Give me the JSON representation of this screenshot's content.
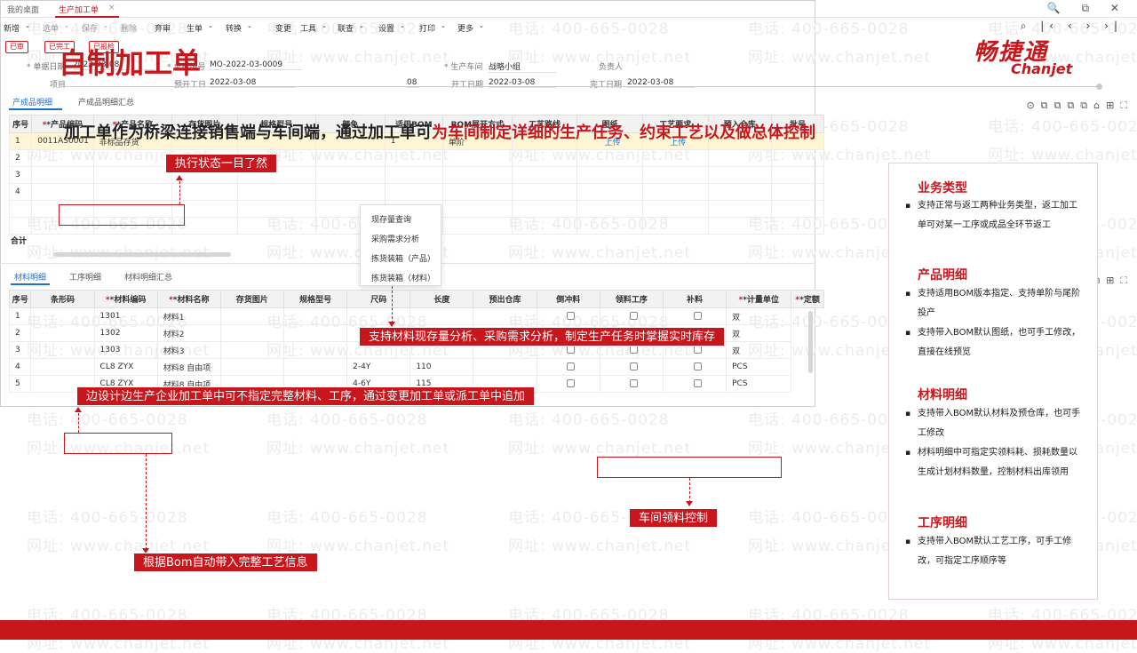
{
  "watermark": {
    "phone": "电话: 400-665-0028",
    "web": "网址: www.chanjet.net"
  },
  "slide": {
    "title": "自制加工单",
    "subtitle_plain": "加工单作为桥梁连接销售端与车间端，通过加工单可",
    "subtitle_highlight": "为车间制定详细的生产任务、约束工艺以及做总体控制",
    "logo_cn": "畅捷通",
    "logo_en": "Chanjet"
  },
  "app": {
    "tabs": [
      "我的桌面",
      "生产加工单"
    ],
    "close_icon": "×",
    "window_icons": "🔍 ⧉ ✕",
    "toolbar": [
      "新增",
      "选单",
      "保存",
      "删除",
      "弃审",
      "生单",
      "转换",
      "变更",
      "工具",
      "联查",
      "设置",
      "打印",
      "更多"
    ],
    "nav_icons": "⌕ |‹ ‹ › ›|",
    "status_buttons": [
      "已审",
      "已完工",
      "已报检"
    ],
    "fields": {
      "date_label": "* 单据日期",
      "date_value": "2022-03-08",
      "number_label": "* 单据编号",
      "number_value": "MO-2022-03-0009",
      "workshop_label": "* 生产车间",
      "workshop_value": "战略小组",
      "owner_label": "负责人",
      "project_label": "项目",
      "plan_label": "预开工日",
      "plan_value": "2022-03-08",
      "start_label": "开工日期",
      "start_value": "2022-03-08",
      "finish_label": "完工日期",
      "finish_value": "2022-03-08",
      "partial_value": "08"
    },
    "tools_dropdown": [
      "现存量查询",
      "采购需求分析",
      "拣货装箱（产品）",
      "拣货装箱（材料）"
    ],
    "product_tabs": [
      "产成品明细",
      "产成品明细汇总"
    ],
    "product_table": {
      "headers": [
        "序号",
        "*产品编码",
        "*产品名称",
        "存货图片",
        "规格型号",
        "颜色",
        "适用BOM",
        "BOM展开方式",
        "工艺路线",
        "图纸",
        "工艺要求",
        "预入仓库",
        "批号"
      ],
      "rows": [
        [
          "1",
          "0011AS0001",
          "非标品存货",
          "",
          "",
          "",
          "1",
          "单阶",
          "",
          "上传",
          "上传",
          "",
          ""
        ],
        [
          "2",
          "",
          "",
          "",
          "",
          "",
          "",
          "",
          "",
          "",
          "",
          "",
          ""
        ],
        [
          "3",
          "",
          "",
          "",
          "",
          "",
          "",
          "",
          "",
          "",
          "",
          "",
          ""
        ],
        [
          "4",
          "",
          "",
          "",
          "",
          "",
          "",
          "",
          "",
          "",
          "",
          "",
          ""
        ],
        [
          "",
          "",
          "",
          "",
          "",
          "",
          "",
          "",
          "",
          "",
          "",
          "",
          ""
        ],
        [
          "",
          "",
          "",
          "",
          "",
          "",
          "",
          "",
          "",
          "",
          "",
          "",
          ""
        ]
      ],
      "total_label": "合计"
    },
    "material_tabs": [
      "材料明细",
      "工序明细",
      "材料明细汇总"
    ],
    "material_table": {
      "headers": [
        "序号",
        "条形码",
        "*材料编码",
        "*材料名称",
        "存货图片",
        "规格型号",
        "尺码",
        "长度",
        "预出仓库",
        "倒冲料",
        "领料工序",
        "补料",
        "*计量单位",
        "*定额"
      ],
      "rows": [
        [
          "1",
          "",
          "1301",
          "材料1",
          "",
          "",
          "",
          "",
          "",
          "",
          "",
          "",
          "双"
        ],
        [
          "2",
          "",
          "1302",
          "材料2",
          "",
          "",
          "",
          "",
          "",
          "",
          "",
          "",
          "双"
        ],
        [
          "3",
          "",
          "1303",
          "材料3",
          "",
          "",
          "",
          "",
          "",
          "",
          "",
          "",
          "双"
        ],
        [
          "4",
          "",
          "CL8 ZYX",
          "材料8 自由项",
          "",
          "",
          "2-4Y",
          "110",
          "",
          "",
          "",
          "",
          "PCS"
        ],
        [
          "5",
          "",
          "CL8 ZYX",
          "材料8 自由项",
          "",
          "",
          "4-6Y",
          "115",
          "",
          "",
          "",
          "",
          "PCS"
        ]
      ]
    }
  },
  "callouts": {
    "status": "执行状态一目了然",
    "stock": "支持材料现存量分析、采购需求分析，制定生产任务时掌握实时库存",
    "design": "边设计边生产企业加工单中可不指定完整材料、工序，通过变更加工单或派工单中追加",
    "workshop": "车间领料控制",
    "bom": "根据Bom自动带入完整工艺信息"
  },
  "panel": {
    "sections": [
      {
        "title": "业务类型",
        "bullets": [
          "支持正常与返工两种业务类型，返工加工单可对某一工序或成品全环节返工"
        ]
      },
      {
        "title": "产品明细",
        "bullets": [
          "支持适用BOM版本指定、支持单阶与尾阶投产",
          "支持带入BOM默认图纸，也可手工修改，直接在线预览"
        ]
      },
      {
        "title": "材料明细",
        "bullets": [
          "支持带入BOM默认材料及预仓库，也可手工修改",
          "材料明细中可指定实领料耗、损耗数量以生成计划材料数量，控制材料出库领用"
        ]
      },
      {
        "title": "工序明细",
        "bullets": [
          "支持带入BOM默认工艺工序，可手工修改，可指定工序顺序等"
        ]
      }
    ]
  },
  "colors": {
    "brand": "#c8161d",
    "link": "#1f6fd1"
  }
}
